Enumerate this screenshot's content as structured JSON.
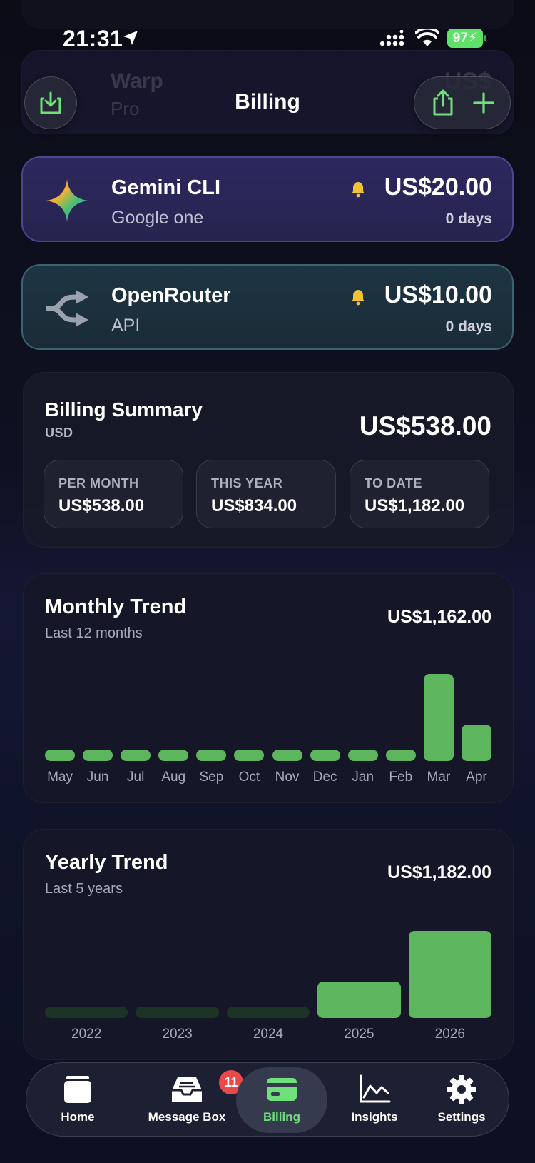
{
  "status_bar": {
    "time": "21:31",
    "battery": "97"
  },
  "background_rows": {
    "warp_name": "Warp",
    "warp_plan": "Pro",
    "warp_price": "US$"
  },
  "nav": {
    "title": "Billing"
  },
  "subscriptions": [
    {
      "name": "Gemini CLI",
      "plan": "Google one",
      "price": "US$20.00",
      "days": "0 days"
    },
    {
      "name": "OpenRouter",
      "plan": "API",
      "price": "US$10.00",
      "days": "0 days"
    }
  ],
  "summary": {
    "title": "Billing Summary",
    "currency": "USD",
    "total": "US$538.00",
    "stats": [
      {
        "label": "PER MONTH",
        "value": "US$538.00"
      },
      {
        "label": "THIS YEAR",
        "value": "US$834.00"
      },
      {
        "label": "TO DATE",
        "value": "US$1,182.00"
      }
    ]
  },
  "monthly_trend": {
    "title": "Monthly Trend",
    "subtitle": "Last 12 months",
    "total": "US$1,162.00"
  },
  "yearly_trend": {
    "title": "Yearly Trend",
    "subtitle": "Last 5 years",
    "total": "US$1,182.00"
  },
  "chart_data": [
    {
      "type": "bar",
      "title": "Monthly Trend",
      "categories": [
        "May",
        "Jun",
        "Jul",
        "Aug",
        "Sep",
        "Oct",
        "Nov",
        "Dec",
        "Jan",
        "Feb",
        "Mar",
        "Apr"
      ],
      "values": [
        0,
        0,
        0,
        0,
        0,
        0,
        0,
        0,
        0,
        0,
        818,
        344
      ]
    },
    {
      "type": "bar",
      "title": "Yearly Trend",
      "categories": [
        "2022",
        "2023",
        "2024",
        "2025",
        "2026"
      ],
      "values": [
        0,
        0,
        0,
        348,
        834
      ]
    }
  ],
  "tab_bar": {
    "items": [
      {
        "label": "Home",
        "icon": "home-icon"
      },
      {
        "label": "Message Box",
        "icon": "inbox-icon",
        "badge": "11"
      },
      {
        "label": "Billing",
        "icon": "card-icon",
        "active": true
      },
      {
        "label": "Insights",
        "icon": "chart-line-icon"
      },
      {
        "label": "Settings",
        "icon": "gear-icon"
      }
    ]
  },
  "colors": {
    "accent": "#5db55e",
    "active_label": "#6fe07a",
    "bell": "#f2c230",
    "badge": "#e84a4a"
  }
}
